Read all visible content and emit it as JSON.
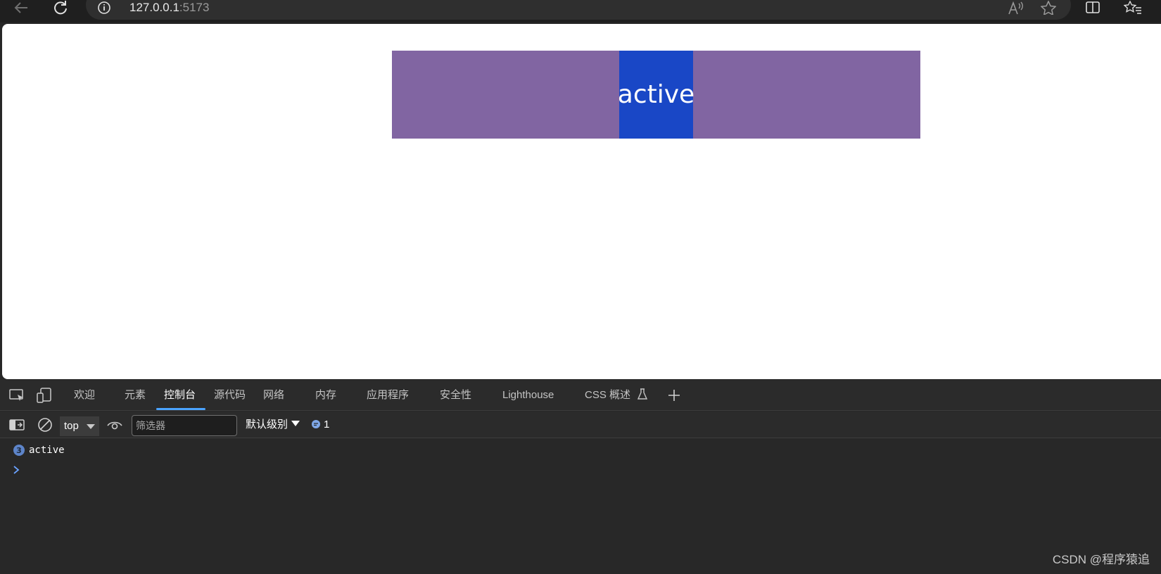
{
  "browser": {
    "url_host": "127.0.0.1",
    "url_port": ":5173",
    "icons": [
      "back-arrow-icon",
      "refresh-icon",
      "info-icon",
      "read-aloud-icon",
      "favorite-star-icon",
      "split-screen-icon",
      "favorites-list-icon"
    ]
  },
  "page": {
    "banner_color": "#8165a2",
    "active_label": "active",
    "active_color": "#1947c6"
  },
  "devtools": {
    "tabs": [
      {
        "label": "欢迎"
      },
      {
        "label": "元素"
      },
      {
        "label": "控制台",
        "selected": true
      },
      {
        "label": "源代码"
      },
      {
        "label": "网络"
      },
      {
        "label": "内存"
      },
      {
        "label": "应用程序"
      },
      {
        "label": "安全性"
      },
      {
        "label": "Lighthouse"
      },
      {
        "label": "CSS 概述"
      }
    ],
    "accent": "#4aa3ff",
    "toolbar": {
      "context": "top",
      "filter_placeholder": "筛选器",
      "level": "默认级别",
      "message_count": "1"
    },
    "console": {
      "entries": [
        {
          "badge": "3",
          "text": "active"
        }
      ]
    }
  },
  "watermark": "CSDN @程序猿追"
}
